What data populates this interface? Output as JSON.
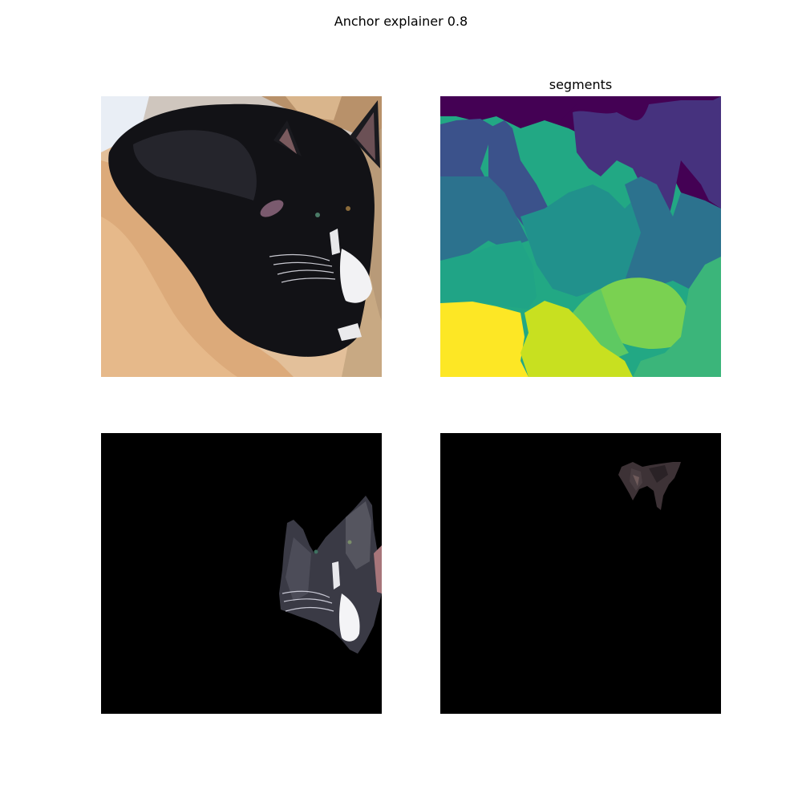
{
  "figure": {
    "suptitle": "Anchor explainer 0.8",
    "panels": [
      {
        "id": "original",
        "title": ""
      },
      {
        "id": "segments",
        "title": "segments"
      },
      {
        "id": "anchor-1",
        "title": ""
      },
      {
        "id": "anchor-2",
        "title": ""
      }
    ]
  },
  "colors": {
    "background": "#ffffff",
    "mask": "#000000",
    "viridis": [
      "#440154",
      "#414487",
      "#2a788e",
      "#22a884",
      "#7ad151",
      "#fde725",
      "#c8e020",
      "#3bb57a",
      "#5ec962",
      "#2f6f8e"
    ]
  }
}
